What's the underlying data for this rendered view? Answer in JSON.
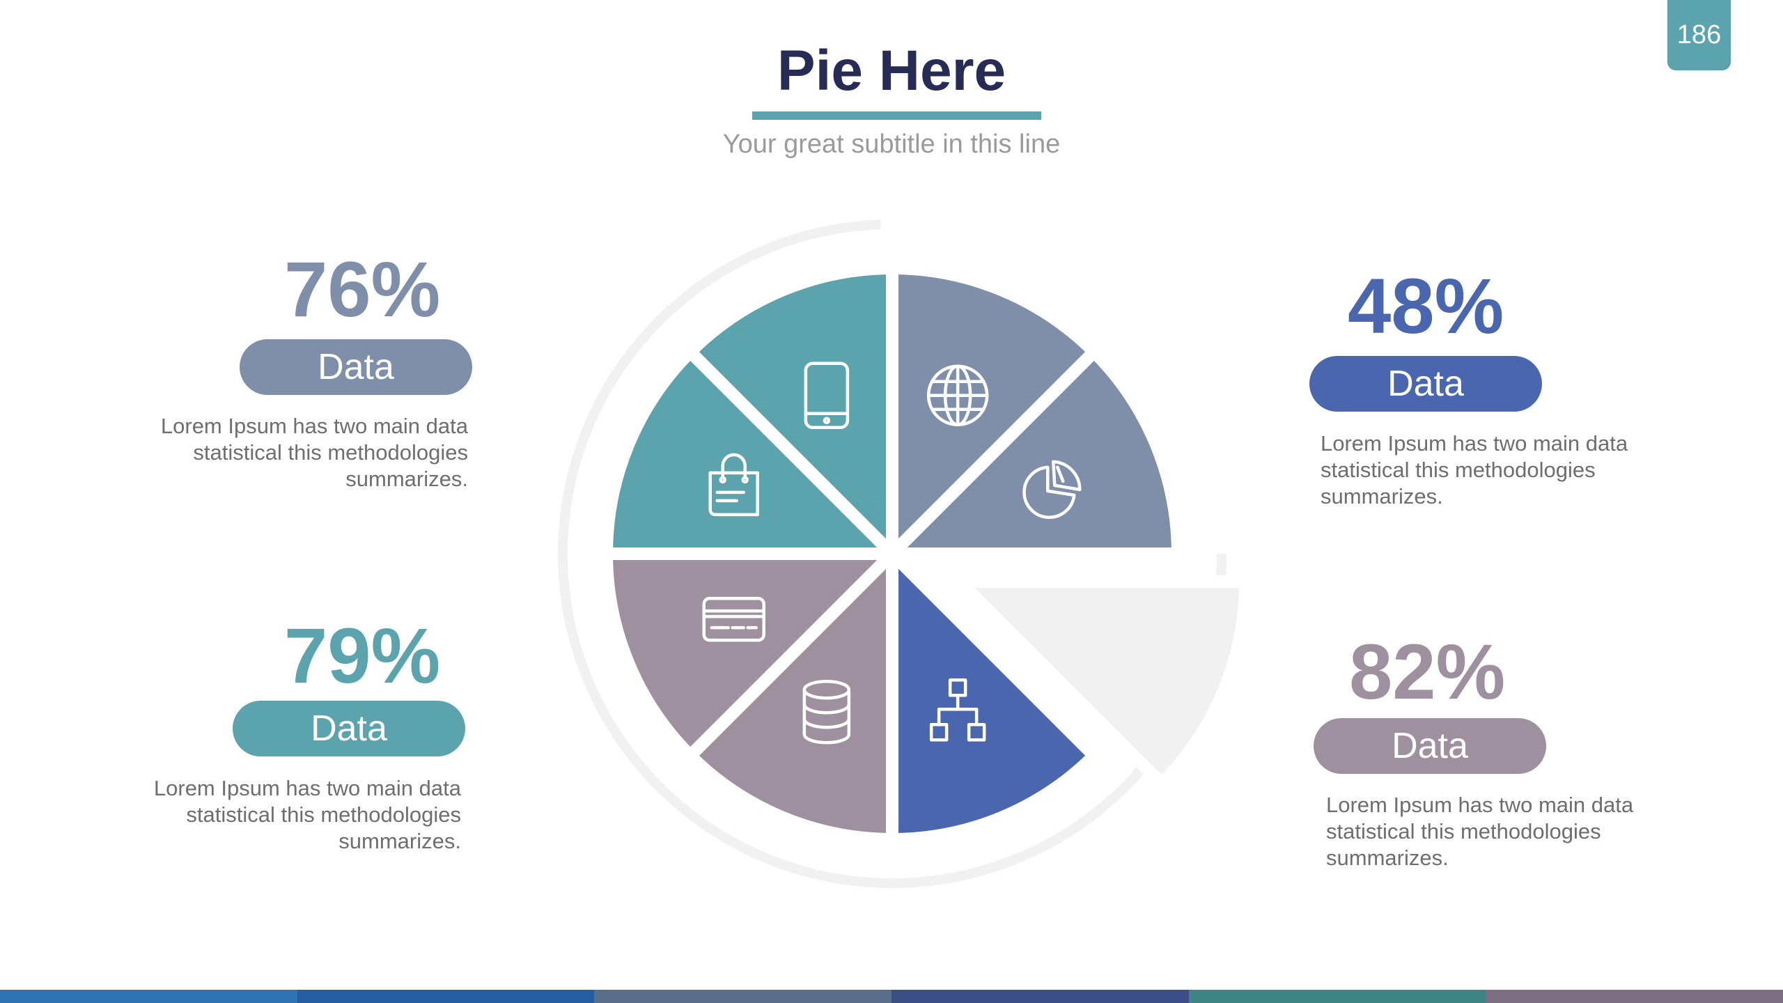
{
  "slide": {
    "title": "Pie Here",
    "subtitle": "Your great subtitle in this line",
    "page_number": "186"
  },
  "colors": {
    "slate": "#7f8faa",
    "teal": "#5ba4ad",
    "blue": "#4a66ae",
    "mauve": "#9e909f",
    "light_gray": "#f1f1f1",
    "title": "#262c55"
  },
  "chart_data": {
    "type": "pie",
    "slices": [
      {
        "color": "#7f8faa",
        "icon": "globe-icon"
      },
      {
        "color": "#7f8faa",
        "icon": "pie-chart-icon"
      },
      {
        "color": "#f1f1f1",
        "icon": "",
        "exploded": true
      },
      {
        "color": "#4a66ae",
        "icon": "network-icon"
      },
      {
        "color": "#9e909f",
        "icon": "database-icon"
      },
      {
        "color": "#9e909f",
        "icon": "credit-card-icon"
      },
      {
        "color": "#5ba4ad",
        "icon": "shopping-bag-icon"
      },
      {
        "color": "#5ba4ad",
        "icon": "tablet-icon"
      }
    ],
    "legend": "none"
  },
  "stats": [
    {
      "value": "76%",
      "label": "Data",
      "text": [
        "Lorem Ipsum has two main data",
        "statistical this methodologies",
        "summarizes."
      ],
      "color": "#7f8faa"
    },
    {
      "value": "79%",
      "label": "Data",
      "text": [
        "Lorem Ipsum has two main data",
        "statistical this methodologies",
        "summarizes."
      ],
      "color": "#5ba4ad"
    },
    {
      "value": "48%",
      "label": "Data",
      "text": [
        "Lorem Ipsum has two main data",
        "statistical this methodologies",
        "summarizes."
      ],
      "color": "#4a66ae"
    },
    {
      "value": "82%",
      "label": "Data",
      "text": [
        "Lorem Ipsum has two main data",
        "statistical this methodologies",
        "summarizes."
      ],
      "color": "#9e909f"
    }
  ],
  "bottom_bar": [
    "#2f73b3",
    "#245ea1",
    "#5a6d8b",
    "#3b4f86",
    "#3f8485",
    "#7d6d80"
  ]
}
